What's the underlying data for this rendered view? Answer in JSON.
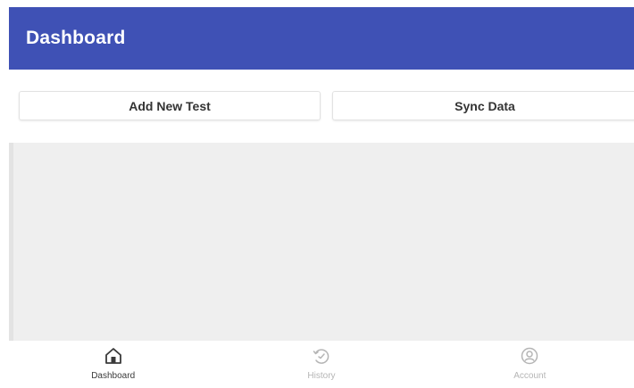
{
  "app_bar": {
    "title": "Dashboard",
    "color": "#3f51b5"
  },
  "actions": {
    "add_new_test_label": "Add New Test",
    "sync_data_label": "Sync Data"
  },
  "bottom_nav": {
    "items": [
      {
        "label": "Dashboard",
        "icon": "home-icon",
        "active": true
      },
      {
        "label": "History",
        "icon": "history-icon",
        "active": false
      },
      {
        "label": "Account",
        "icon": "account-icon",
        "active": false
      }
    ],
    "active_color": "#3a3a3a",
    "inactive_color": "#b5b5b5"
  }
}
